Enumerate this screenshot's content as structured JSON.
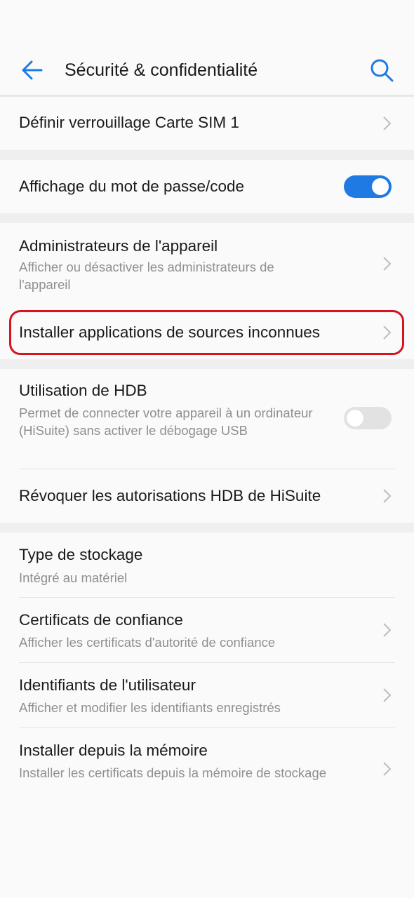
{
  "header": {
    "title": "Sécurité & confidentialité",
    "back_icon": "arrow-left-icon",
    "search_icon": "search-icon",
    "accent": "#1f7ae3"
  },
  "rows": {
    "sim_lock": {
      "title": "Définir verrouillage Carte SIM 1"
    },
    "show_password": {
      "title": "Affichage du mot de passe/code",
      "toggle_on": true
    },
    "device_admins": {
      "title": "Administrateurs de l'appareil",
      "subtitle": "Afficher ou désactiver les administrateurs de l'appareil"
    },
    "unknown_sources": {
      "title": "Installer applications de sources inconnues",
      "highlight_color": "#d7141e"
    },
    "hdb": {
      "title": "Utilisation de HDB",
      "subtitle": "Permet de connecter votre appareil à un ordinateur (HiSuite) sans activer le débogage USB",
      "toggle_on": false
    },
    "revoke_hdb": {
      "title": "Révoquer les autorisations HDB de HiSuite"
    },
    "storage_type": {
      "title": "Type de stockage",
      "subtitle": "Intégré au matériel"
    },
    "trusted_certs": {
      "title": "Certificats de confiance",
      "subtitle": "Afficher les certificats d'autorité de confiance"
    },
    "user_credentials": {
      "title": "Identifiants de l'utilisateur",
      "subtitle": "Afficher et modifier les identifiants enregistrés"
    },
    "install_from_storage": {
      "title": "Installer depuis la mémoire",
      "subtitle": "Installer les certificats depuis la mémoire de stockage"
    }
  }
}
